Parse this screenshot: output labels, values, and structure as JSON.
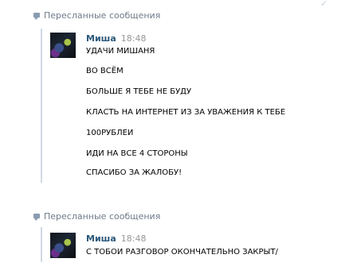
{
  "forwards": [
    {
      "header": "Пересланные сообщения",
      "author": "Миша",
      "time": "18:48",
      "lines": [
        "УДАЧИ МИШАНЯ",
        "ВО ВСЁМ",
        "БОЛЬШЕ Я ТЕБЕ НЕ БУДУ",
        "КЛАСТЬ НА ИНТЕРНЕТ ИЗ ЗА УВАЖЕНИЯ К ТЕБЕ",
        "100РУБЛЕИ",
        "ИДИ НА ВСЕ 4 СТОРОНЫ",
        "СПАСИБО ЗА ЖАЛОБУ!"
      ]
    },
    {
      "header": "Пересланные сообщения",
      "author": "Миша",
      "time": "18:48",
      "lines": [
        "С ТОБОИ РАЗГОВОР ОКОНЧАТЕЛЬНО ЗАКРЫТ/"
      ]
    }
  ]
}
